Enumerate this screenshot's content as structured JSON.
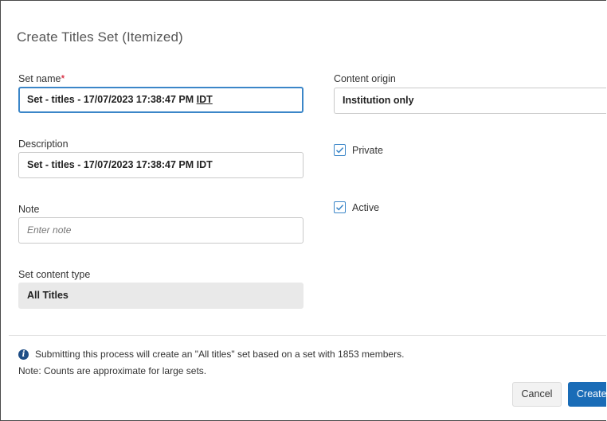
{
  "dialog": {
    "title": "Create Titles Set (Itemized)"
  },
  "form": {
    "set_name": {
      "label": "Set name",
      "required_mark": "*",
      "value_main": "Set - titles - 17/07/2023 17:38:47 PM ",
      "value_underlined": "IDT"
    },
    "content_origin": {
      "label": "Content origin",
      "value": "Institution only"
    },
    "description": {
      "label": "Description",
      "value": "Set - titles - 17/07/2023 17:38:47 PM IDT"
    },
    "private": {
      "label": "Private",
      "checked": true
    },
    "note": {
      "label": "Note",
      "placeholder": "Enter note",
      "value": ""
    },
    "active": {
      "label": "Active",
      "checked": true
    },
    "set_content_type": {
      "label": "Set content type",
      "value": "All Titles"
    }
  },
  "footer": {
    "info_icon": "info-icon",
    "info_text": "Submitting this process will create an \"All titles\" set based on a set with 1853 members.",
    "note_text": "Note: Counts are approximate for large sets.",
    "cancel_label": "Cancel",
    "create_label": "Create"
  },
  "colors": {
    "accent": "#1a6cb7",
    "focus_border": "#3b86c8",
    "required": "#d0021b",
    "readonly_bg": "#e9e9e9"
  }
}
